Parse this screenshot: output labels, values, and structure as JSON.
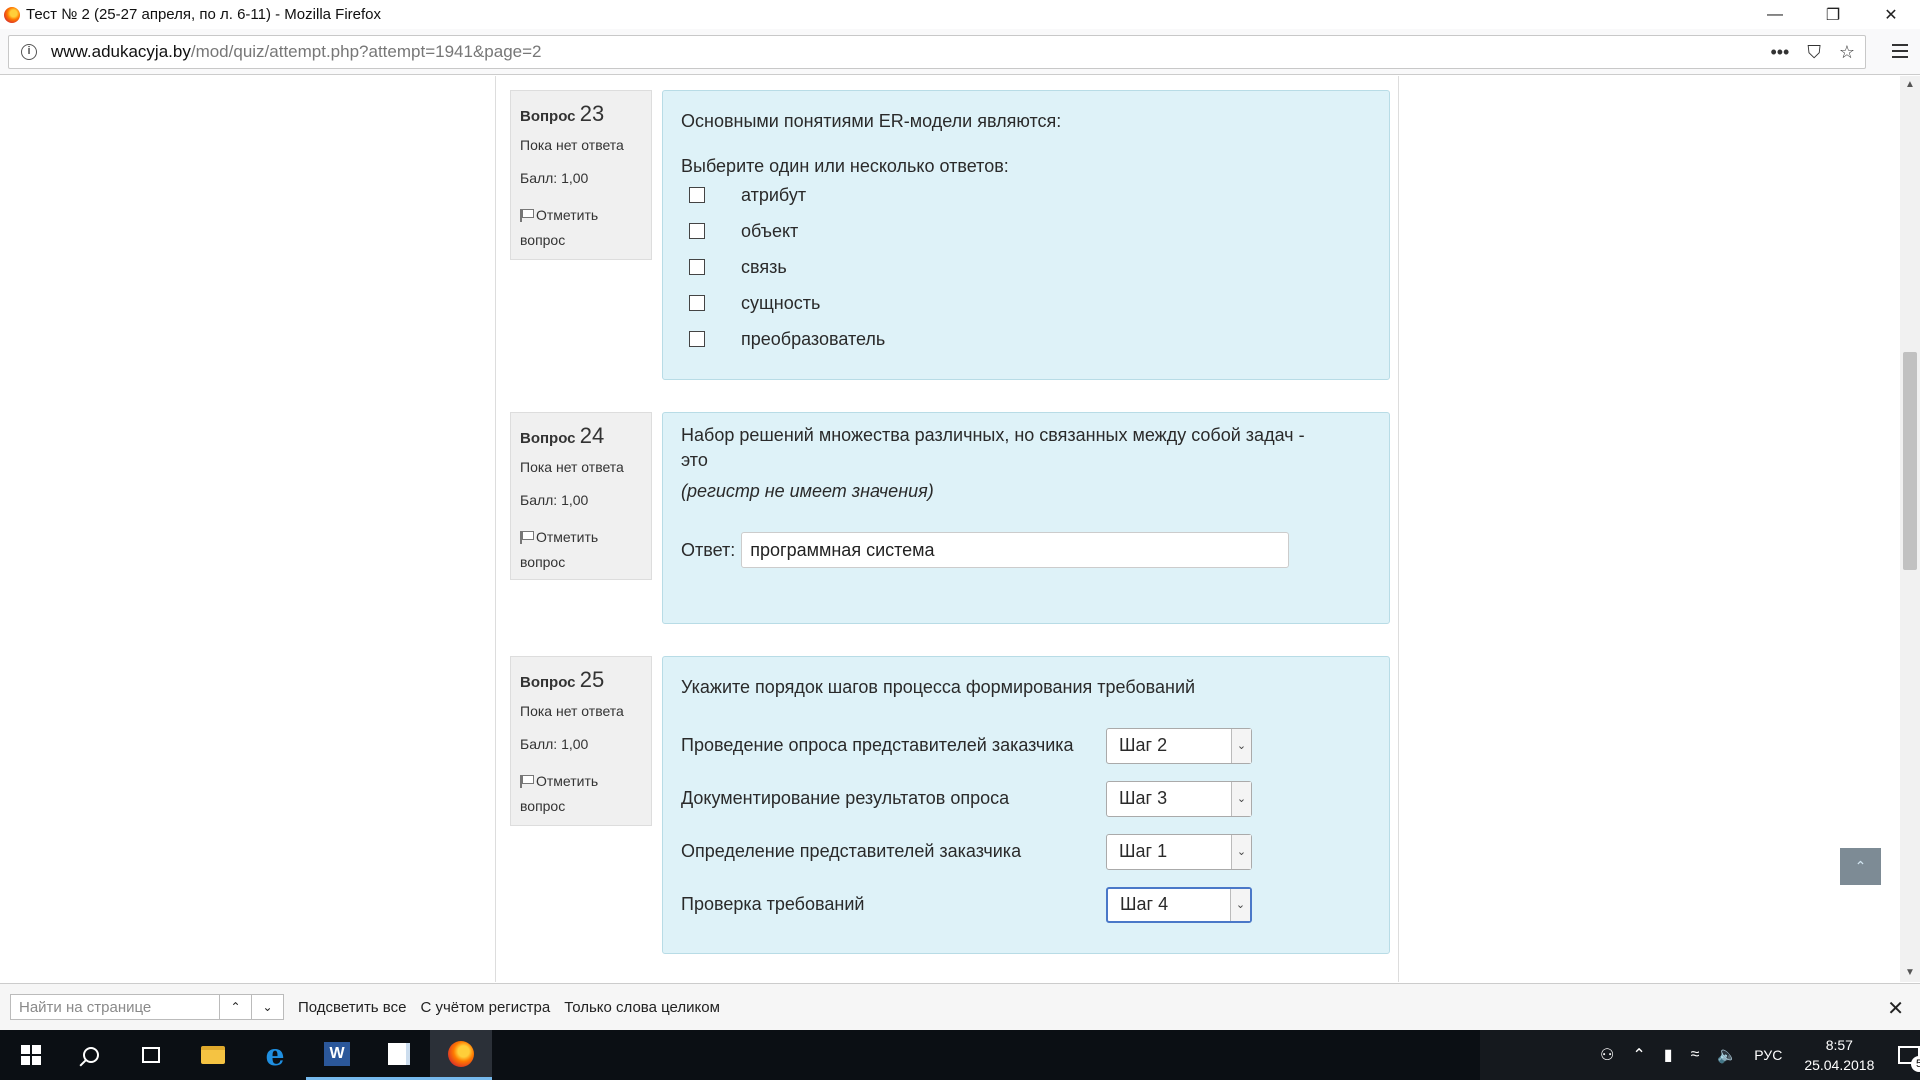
{
  "window": {
    "title": "Тест № 2 (25-27 апреля, по л. 6-11) - Mozilla Firefox",
    "minimize": "—",
    "restore": "❐",
    "close": "✕"
  },
  "browser": {
    "url_host": "www.adukacyja.by",
    "url_path": "/mod/quiz/attempt.php?attempt=1941&page=2",
    "more_icon": "•••",
    "pocket_icon": "⛉",
    "bookmark_icon": "☆"
  },
  "questions": [
    {
      "label": "Вопрос",
      "number": "23",
      "state": "Пока нет ответа",
      "grade": "Балл: 1,00",
      "flag_label": "Отметить вопрос",
      "text": "Основными понятиями ER-модели являются:",
      "prompt": "Выберите один или несколько ответов:",
      "options": [
        "атрибут",
        "объект",
        "связь",
        "сущность",
        "преобразователь"
      ]
    },
    {
      "label": "Вопрос",
      "number": "24",
      "state": "Пока нет ответа",
      "grade": "Балл: 1,00",
      "flag_label": "Отметить вопрос",
      "text": "Набор решений множества различных, но связанных между собой задач - это",
      "hint": "(регистр не имеет значения)",
      "answer_label": "Ответ:",
      "answer_value": "программная система"
    },
    {
      "label": "Вопрос",
      "number": "25",
      "state": "Пока нет ответа",
      "grade": "Балл: 1,00",
      "flag_label": "Отметить вопрос",
      "text": "Укажите порядок шагов процесса формирования требований",
      "rows": [
        {
          "label": "Проведение опроса представителей заказчика",
          "value": "Шаг 2"
        },
        {
          "label": "Документирование результатов опроса",
          "value": "Шаг 3"
        },
        {
          "label": "Определение представителей заказчика",
          "value": "Шаг 1"
        },
        {
          "label": "Проверка требований",
          "value": "Шаг 4"
        }
      ]
    }
  ],
  "findbar": {
    "placeholder": "Найти на странице",
    "highlight_all": "Подсветить все",
    "match_case": "С учётом регистра",
    "whole_words": "Только слова целиком"
  },
  "taskbar": {
    "lang": "РУС",
    "time": "8:57",
    "date": "25.04.2018",
    "notifications": "5"
  }
}
